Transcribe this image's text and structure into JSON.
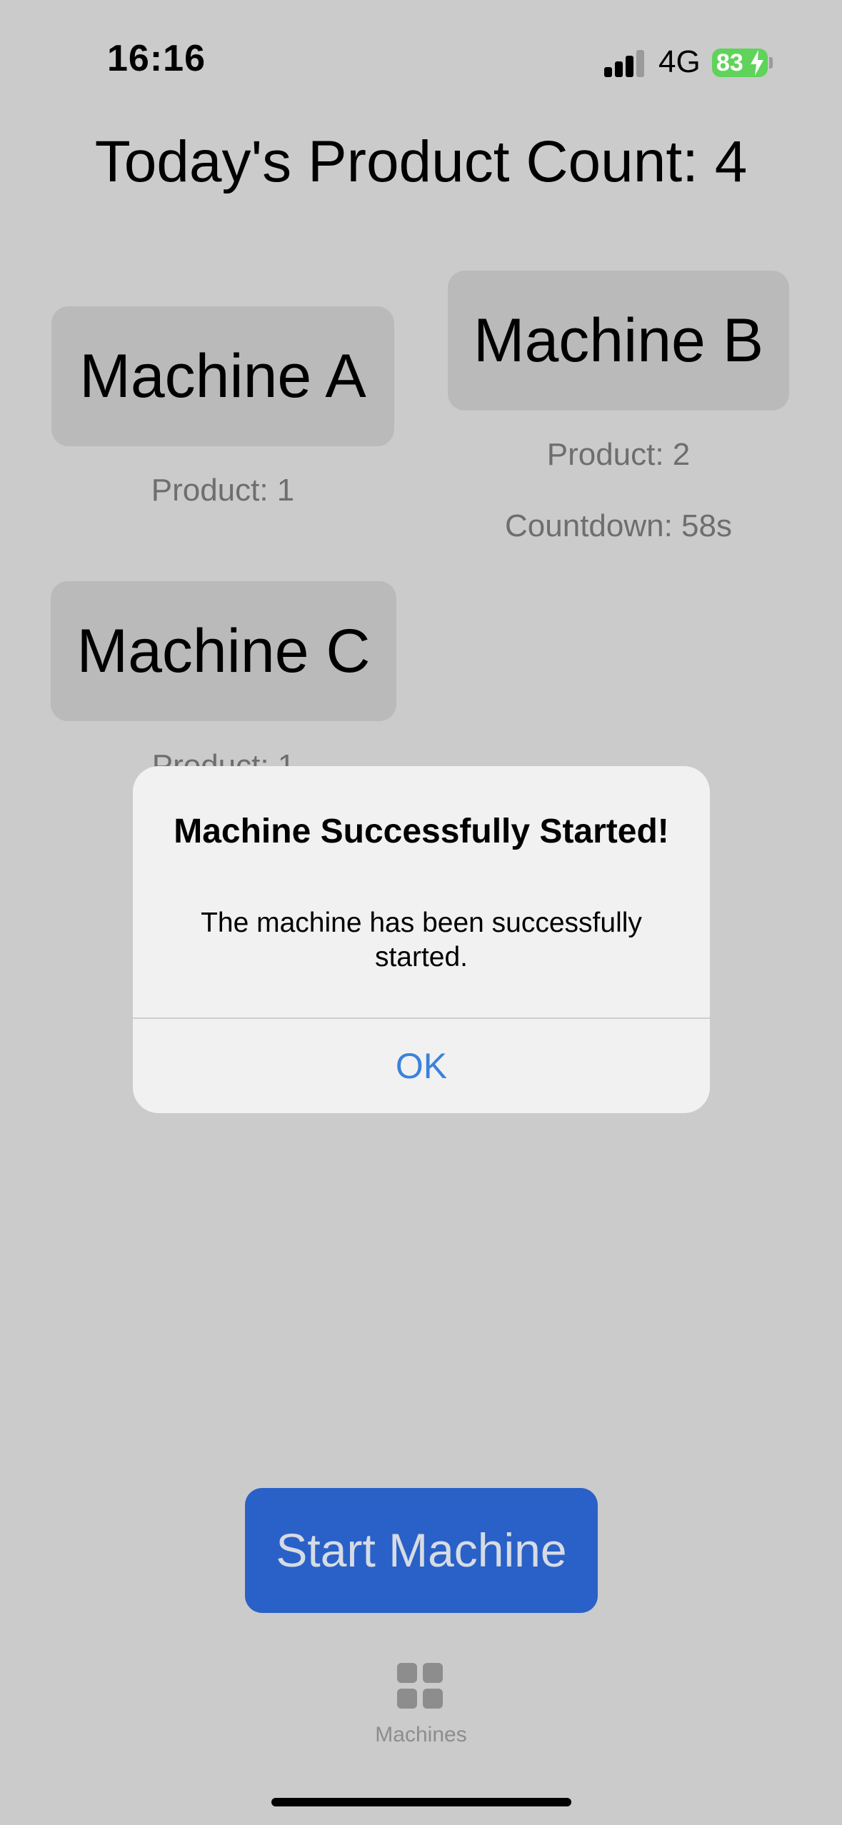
{
  "status_bar": {
    "time": "16:16",
    "network": "4G",
    "battery": "83",
    "icons": [
      "signal-icon",
      "battery-icon",
      "charging-bolt-icon"
    ]
  },
  "header": {
    "title": "Today's Product Count: 4"
  },
  "machines": [
    {
      "name": "Machine A",
      "product": "Product: 1",
      "countdown": ""
    },
    {
      "name": "Machine B",
      "product": "Product: 2",
      "countdown": "Countdown: 58s"
    },
    {
      "name": "Machine C",
      "product": "Product: 1",
      "countdown": ""
    }
  ],
  "dialog": {
    "title": "Machine Successfully Started!",
    "message": "The machine has been successfully started.",
    "ok_label": "OK"
  },
  "actions": {
    "start_label": "Start Machine"
  },
  "tab_bar": {
    "items": [
      {
        "label": "Machines",
        "icon": "grid-icon"
      }
    ]
  },
  "colors": {
    "primary": "#2a61c8",
    "link": "#3b82dc",
    "battery": "#5fd35a"
  }
}
